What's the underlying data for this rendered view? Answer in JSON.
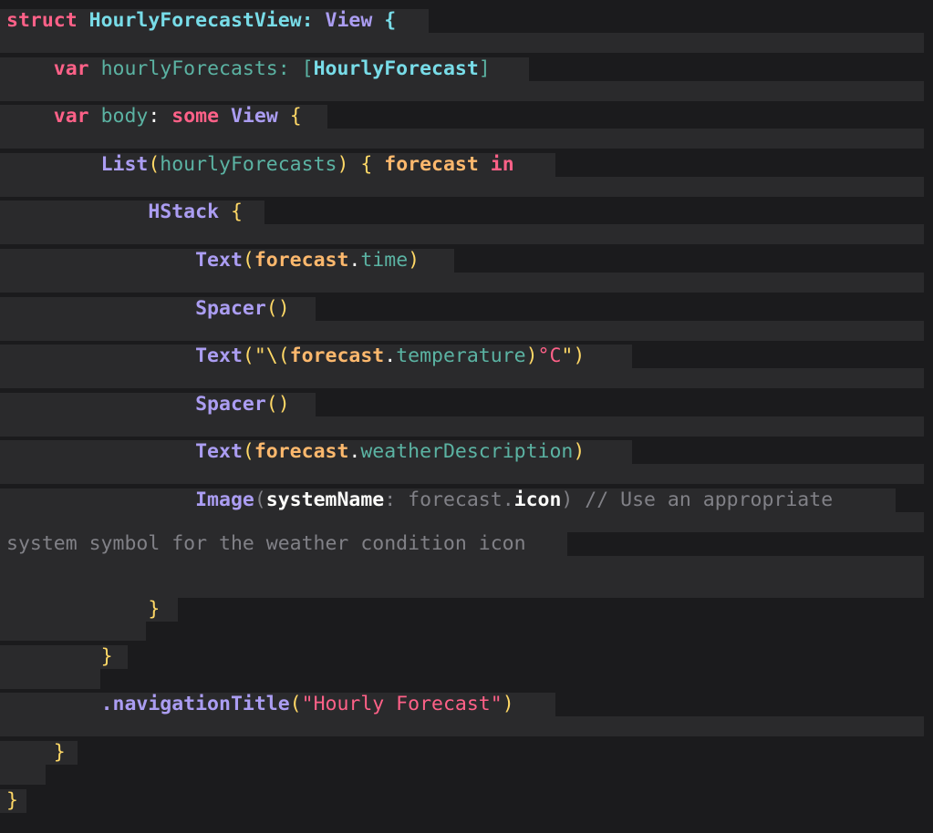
{
  "code": {
    "language": "swift",
    "lines": [
      [
        {
          "t": "struct",
          "c": "kw"
        },
        {
          "t": " ",
          "c": "white"
        },
        {
          "t": "HourlyForecastView",
          "c": "type"
        },
        {
          "t": ": ",
          "c": "type"
        },
        {
          "t": "View",
          "c": "func"
        },
        {
          "t": " {",
          "c": "type"
        }
      ],
      [
        {
          "t": "    ",
          "c": "white"
        },
        {
          "t": "var",
          "c": "kw"
        },
        {
          "t": " hourlyForecasts: [",
          "c": "prop"
        },
        {
          "t": "HourlyForecast",
          "c": "type"
        },
        {
          "t": "]",
          "c": "prop"
        }
      ],
      [
        {
          "t": "    ",
          "c": "white"
        },
        {
          "t": "var",
          "c": "kw"
        },
        {
          "t": " body",
          "c": "prop"
        },
        {
          "t": ": ",
          "c": "white"
        },
        {
          "t": "some",
          "c": "kw"
        },
        {
          "t": " ",
          "c": "white"
        },
        {
          "t": "View",
          "c": "func"
        },
        {
          "t": " {",
          "c": "punct"
        }
      ],
      [
        {
          "t": "        ",
          "c": "white"
        },
        {
          "t": "List",
          "c": "func"
        },
        {
          "t": "(",
          "c": "punct"
        },
        {
          "t": "hourlyForecasts",
          "c": "prop"
        },
        {
          "t": ") { ",
          "c": "punct"
        },
        {
          "t": "forecast",
          "c": "ident"
        },
        {
          "t": " ",
          "c": "white"
        },
        {
          "t": "in",
          "c": "kw"
        }
      ],
      [
        {
          "t": "            ",
          "c": "white"
        },
        {
          "t": "HStack",
          "c": "func"
        },
        {
          "t": " {",
          "c": "punct"
        }
      ],
      [
        {
          "t": "                ",
          "c": "white"
        },
        {
          "t": "Text",
          "c": "func"
        },
        {
          "t": "(",
          "c": "punct"
        },
        {
          "t": "forecast",
          "c": "ident"
        },
        {
          "t": ".",
          "c": "white"
        },
        {
          "t": "time",
          "c": "prop"
        },
        {
          "t": ")",
          "c": "punct"
        }
      ],
      [
        {
          "t": "                ",
          "c": "white"
        },
        {
          "t": "Spacer",
          "c": "func"
        },
        {
          "t": "()",
          "c": "punct"
        }
      ],
      [
        {
          "t": "                ",
          "c": "white"
        },
        {
          "t": "Text",
          "c": "func"
        },
        {
          "t": "(\"\\(",
          "c": "punct"
        },
        {
          "t": "forecast",
          "c": "ident"
        },
        {
          "t": ".",
          "c": "white"
        },
        {
          "t": "temperature",
          "c": "prop"
        },
        {
          "t": ")",
          "c": "punct"
        },
        {
          "t": "°C",
          "c": "str"
        },
        {
          "t": "\")",
          "c": "punct"
        }
      ],
      [
        {
          "t": "                ",
          "c": "white"
        },
        {
          "t": "Spacer",
          "c": "func"
        },
        {
          "t": "()",
          "c": "punct"
        }
      ],
      [
        {
          "t": "                ",
          "c": "white"
        },
        {
          "t": "Text",
          "c": "func"
        },
        {
          "t": "(",
          "c": "punct"
        },
        {
          "t": "forecast",
          "c": "ident"
        },
        {
          "t": ".",
          "c": "white"
        },
        {
          "t": "weatherDescription",
          "c": "prop"
        },
        {
          "t": ")",
          "c": "punct"
        }
      ],
      [
        {
          "t": "                ",
          "c": "white"
        },
        {
          "t": "Image",
          "c": "func"
        },
        {
          "t": "(",
          "c": "cmt"
        },
        {
          "t": "systemName",
          "c": "plain"
        },
        {
          "t": ": forecast.",
          "c": "cmt"
        },
        {
          "t": "icon",
          "c": "plain"
        },
        {
          "t": ") // Use an appropriate",
          "c": "cmt"
        }
      ],
      [
        {
          "t": "system symbol for the weather condition icon",
          "c": "cmt"
        }
      ],
      [
        {
          "t": "            ",
          "c": "white"
        },
        {
          "t": "}",
          "c": "punct"
        }
      ],
      [
        {
          "t": "        ",
          "c": "white"
        },
        {
          "t": "}",
          "c": "punct"
        }
      ],
      [
        {
          "t": "        ",
          "c": "white"
        },
        {
          "t": ".navigationTitle",
          "c": "func"
        },
        {
          "t": "(",
          "c": "punct"
        },
        {
          "t": "\"Hourly Forecast\"",
          "c": "str"
        },
        {
          "t": ")",
          "c": "punct"
        }
      ],
      [
        {
          "t": "    ",
          "c": "white"
        },
        {
          "t": "}",
          "c": "punct"
        }
      ],
      [
        {
          "t": "}",
          "c": "punct"
        }
      ]
    ]
  },
  "colors": {
    "background": "#1b1b1d",
    "line_highlight": "#2a2a2c",
    "keyword": "#ff6188",
    "type": "#78dce8",
    "function": "#ab9df2",
    "property": "#5bb3a3",
    "punctuation": "#ffd866",
    "identifier": "#fcb86d",
    "string": "#ff6188",
    "comment": "#818187"
  }
}
